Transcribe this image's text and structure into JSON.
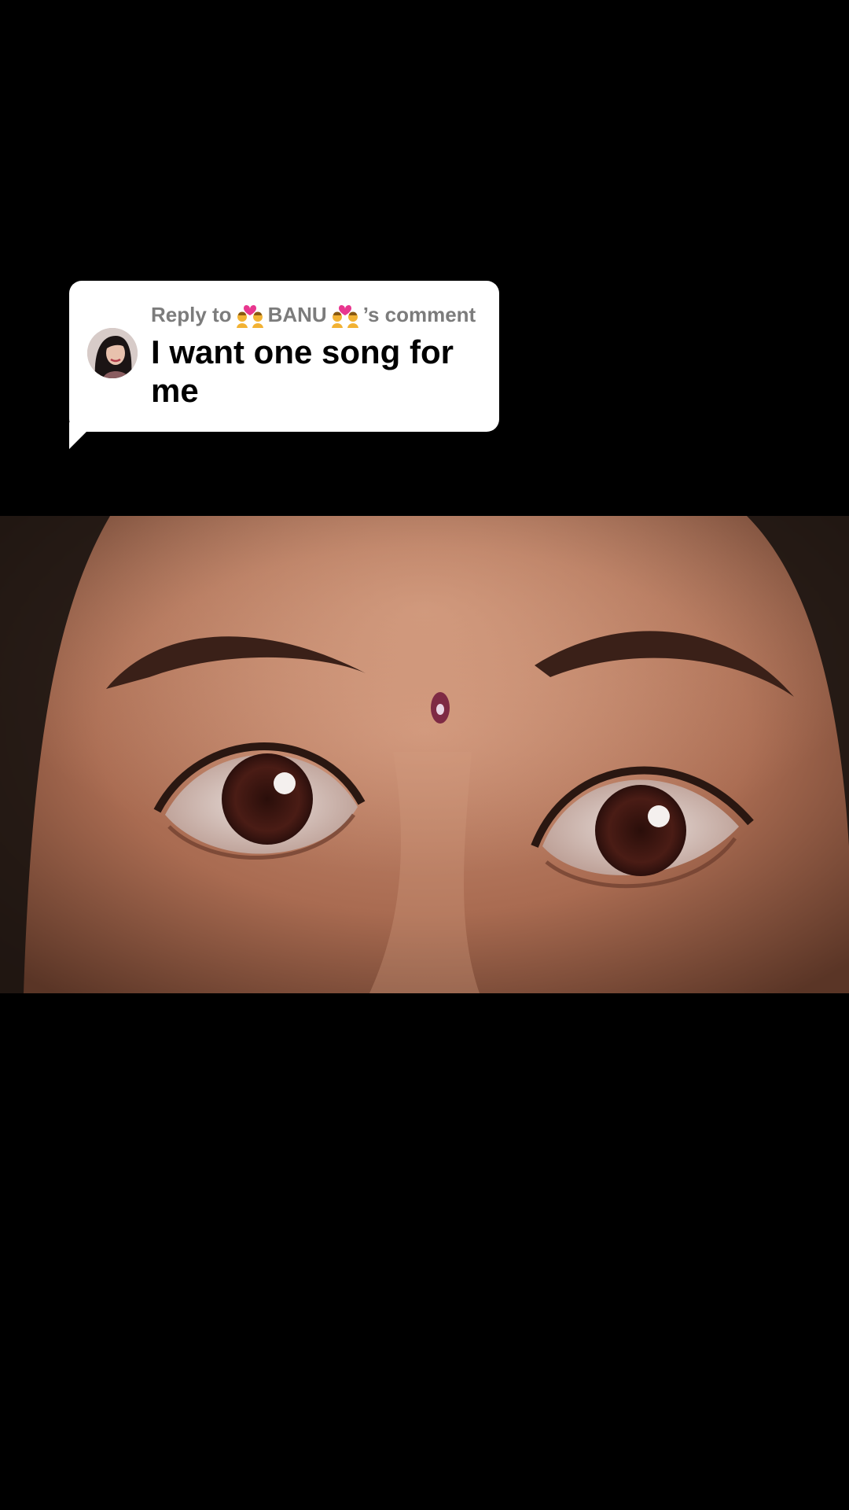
{
  "reply_card": {
    "reply_prefix": "Reply to",
    "username": "BANU",
    "possessive_suffix": "’s comment",
    "comment_text": "I want one song for me",
    "username_emoji": "couple-with-heart-emoji",
    "avatar_icon": "user-avatar"
  },
  "video": {
    "subject": "close-up-eyes-frame"
  },
  "colors": {
    "background": "#000000",
    "card_background": "#ffffff",
    "header_text": "#7c7c7c",
    "comment_text": "#000000"
  }
}
